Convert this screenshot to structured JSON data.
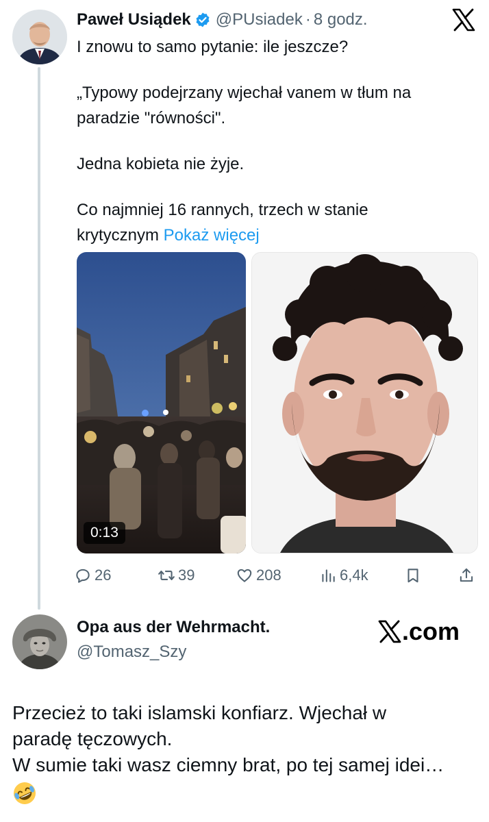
{
  "tweet": {
    "author": {
      "display_name": "Paweł Usiądek",
      "handle": "@PUsiadek",
      "verified": true,
      "avatar_icon": "man-in-suit-portrait"
    },
    "time_separator": "·",
    "time": "8 godz.",
    "text_lines": [
      "I znowu to samo pytanie: ile jeszcze?",
      "„Typowy podejrzany wjechał vanem w tłum na",
      "paradzie \"równości\".",
      "Jedna kobieta nie żyje.",
      "Co najmniej 16 rannych, trzech w stanie",
      "krytycznym"
    ],
    "show_more": "Pokaż więcej",
    "media": {
      "video_duration": "0:13",
      "video_icon": "night-street-crowd-video",
      "photo_icon": "young-man-headshot"
    },
    "actions": {
      "replies": "26",
      "reposts": "39",
      "likes": "208",
      "views": "6,4k"
    }
  },
  "reply": {
    "author": {
      "display_name": "Opa aus der Wehrmacht.",
      "handle": "@Tomasz_Szy",
      "avatar_icon": "soldier-helmet-portrait"
    },
    "site_badge": ".com",
    "text_lines": [
      "Przecież to taki islamski konfiarz. Wjechał w",
      "paradę tęczowych.",
      "W sumie taki wasz ciemny brat, po tej samej idei…"
    ],
    "emoji": "🤣"
  },
  "colors": {
    "text": "#0f1419",
    "secondary": "#536471",
    "link": "#1d9bf0",
    "verified": "#1d9bf0",
    "thread_line": "#cfd9de"
  }
}
